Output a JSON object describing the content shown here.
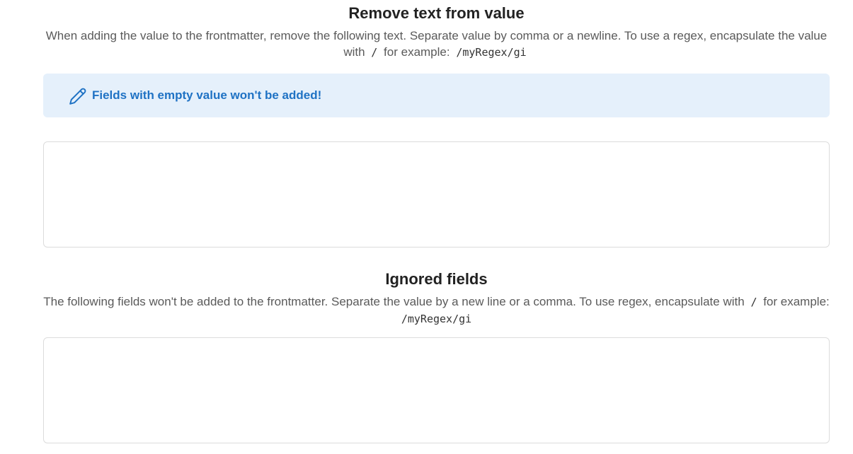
{
  "remove_text": {
    "title": "Remove text from value",
    "desc_before": "When adding the value to the frontmatter, remove the following text. Separate value by comma or a newline. To use a regex, encapsulate the value with",
    "desc_slash": "/",
    "desc_mid": "for example:",
    "desc_example": "/myRegex/gi",
    "callout_icon": "pencil-icon",
    "callout_text": "Fields with empty value won't be added!",
    "textarea_value": ""
  },
  "ignored_fields": {
    "title": "Ignored fields",
    "desc_before": "The following fields won't be added to the frontmatter. Separate the value by a new line or a comma. To use regex, encapsulate with",
    "desc_slash": "/",
    "desc_mid": "for example:",
    "desc_example": "/myRegex/gi",
    "textarea_value": ""
  },
  "colors": {
    "callout_bg": "#e5f0fb",
    "callout_text": "#1f72c4",
    "border": "#dcdcdc"
  }
}
